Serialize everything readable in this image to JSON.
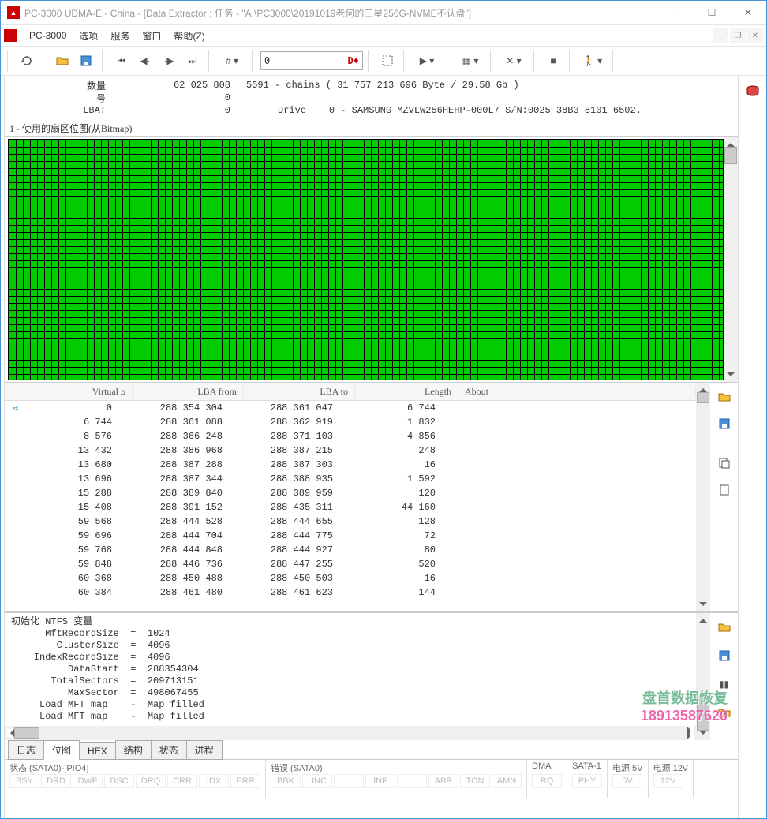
{
  "window": {
    "title": "PC-3000 UDMA-E - China - [Data Extractor : 任务 - \"A:\\PC3000\\20191019老何的三星256G-NVME不认盘\"]"
  },
  "menu": {
    "app": "PC-3000",
    "items": [
      "选项",
      "服务",
      "窗口",
      "帮助(Z)"
    ]
  },
  "toolbar": {
    "address": "0",
    "addressSuffix": "D♦"
  },
  "info": {
    "qty_label": "数量",
    "qty_value": "62 025 808",
    "chains": "5591 - chains  ( 31 757 213 696 Byte /  29.58 Gb )",
    "id_label": "号",
    "id_value": "0",
    "lba_label": "LBA:",
    "lba_value": "0",
    "drive_label": "Drive",
    "drive_value": "0 - SAMSUNG MZVLW256HEHP-000L7  S/N:0025 38B3 8101 6502."
  },
  "bitmap_title": "1 - 使用的扇区位图(从Bitmap)",
  "table": {
    "headers": {
      "virtual": "Virtual  ▵",
      "lba_from": "LBA from",
      "lba_to": "LBA to",
      "length": "Length",
      "about": "About"
    },
    "rows": [
      {
        "v": "0",
        "f": "288 354 304",
        "t": "288 361 047",
        "l": "6 744",
        "ptr": true
      },
      {
        "v": "6 744",
        "f": "288 361 088",
        "t": "288 362 919",
        "l": "1 832"
      },
      {
        "v": "8 576",
        "f": "288 366 248",
        "t": "288 371 103",
        "l": "4 856"
      },
      {
        "v": "13 432",
        "f": "288 386 968",
        "t": "288 387 215",
        "l": "248"
      },
      {
        "v": "13 680",
        "f": "288 387 288",
        "t": "288 387 303",
        "l": "16"
      },
      {
        "v": "13 696",
        "f": "288 387 344",
        "t": "288 388 935",
        "l": "1 592"
      },
      {
        "v": "15 288",
        "f": "288 389 840",
        "t": "288 389 959",
        "l": "120"
      },
      {
        "v": "15 408",
        "f": "288 391 152",
        "t": "288 435 311",
        "l": "44 160"
      },
      {
        "v": "59 568",
        "f": "288 444 528",
        "t": "288 444 655",
        "l": "128"
      },
      {
        "v": "59 696",
        "f": "288 444 704",
        "t": "288 444 775",
        "l": "72"
      },
      {
        "v": "59 768",
        "f": "288 444 848",
        "t": "288 444 927",
        "l": "80"
      },
      {
        "v": "59 848",
        "f": "288 446 736",
        "t": "288 447 255",
        "l": "520"
      },
      {
        "v": "60 368",
        "f": "288 450 488",
        "t": "288 450 503",
        "l": "16"
      },
      {
        "v": "60 384",
        "f": "288 461 480",
        "t": "288 461 623",
        "l": "144"
      }
    ]
  },
  "log": "初始化 NTFS 变量\n      MftRecordSize  =  1024\n        ClusterSize  =  4096\n    IndexRecordSize  =  4096\n          DataStart  =  288354304\n       TotalSectors  =  209713151\n          MaxSector  =  498067455\n     Load MFT map    -  Map filled\n     Load MFT map    -  Map filled",
  "tabs": [
    "日志",
    "位图",
    "HEX",
    "结构",
    "状态",
    "进程"
  ],
  "active_tab": 1,
  "status": {
    "groups": [
      {
        "title": "状态 (SATA0)-[PIO4]",
        "items": [
          "BSY",
          "DRD",
          "DWF",
          "DSC",
          "DRQ",
          "CRR",
          "IDX",
          "ERR"
        ]
      },
      {
        "title": "错误 (SATA0)",
        "items": [
          "BBK",
          "UNC",
          "",
          "INF",
          "",
          "ABR",
          "TON",
          "AMN"
        ]
      },
      {
        "title": "DMA",
        "items": [
          "RQ"
        ]
      },
      {
        "title": "SATA-1",
        "items": [
          "PHY"
        ]
      },
      {
        "title": "电源 5V",
        "items": [
          "5V"
        ]
      },
      {
        "title": "电源 12V",
        "items": [
          "12V"
        ]
      }
    ]
  },
  "watermark": {
    "l1": "盘首数据恢复",
    "l2": "18913587620"
  }
}
